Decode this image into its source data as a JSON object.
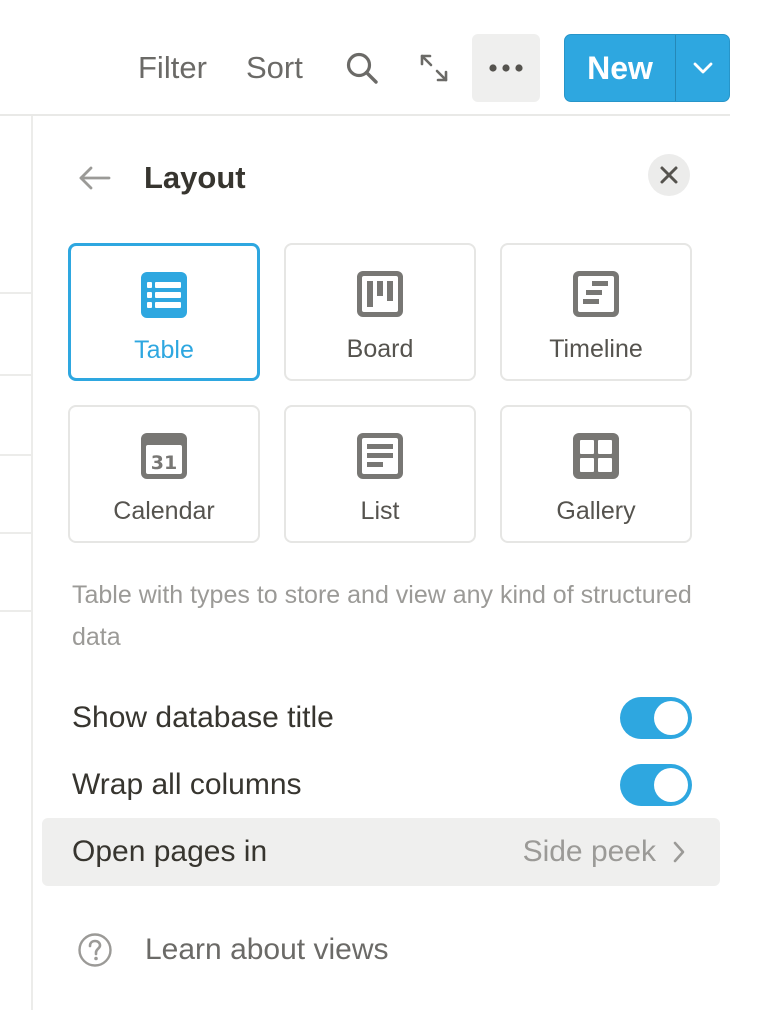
{
  "toolbar": {
    "filter_label": "Filter",
    "sort_label": "Sort",
    "search_icon": "search-icon",
    "expand_icon": "expand-icon",
    "more_icon": "more-horizontal-icon",
    "new_label": "New",
    "new_caret_icon": "chevron-down-icon"
  },
  "panel": {
    "title": "Layout",
    "back_icon": "arrow-left-icon",
    "close_icon": "close-icon",
    "layouts": [
      {
        "label": "Table",
        "icon": "table-icon",
        "selected": true
      },
      {
        "label": "Board",
        "icon": "board-icon",
        "selected": false
      },
      {
        "label": "Timeline",
        "icon": "timeline-icon",
        "selected": false
      },
      {
        "label": "Calendar",
        "icon": "calendar-icon",
        "selected": false,
        "icon_text": "31"
      },
      {
        "label": "List",
        "icon": "list-icon",
        "selected": false
      },
      {
        "label": "Gallery",
        "icon": "gallery-icon",
        "selected": false
      }
    ],
    "description": "Table with types to store and view any kind of structured data",
    "toggles": [
      {
        "label": "Show database title",
        "on": true
      },
      {
        "label": "Wrap all columns",
        "on": true
      }
    ],
    "open_pages": {
      "label": "Open pages in",
      "value": "Side peek",
      "chevron_icon": "chevron-right-icon"
    },
    "learn": {
      "label": "Learn about views",
      "icon": "help-circle-icon"
    }
  },
  "colors": {
    "accent": "#2ea7e0",
    "text": "#37352f",
    "muted": "#9b9a97",
    "hover_bg": "#efefee"
  }
}
